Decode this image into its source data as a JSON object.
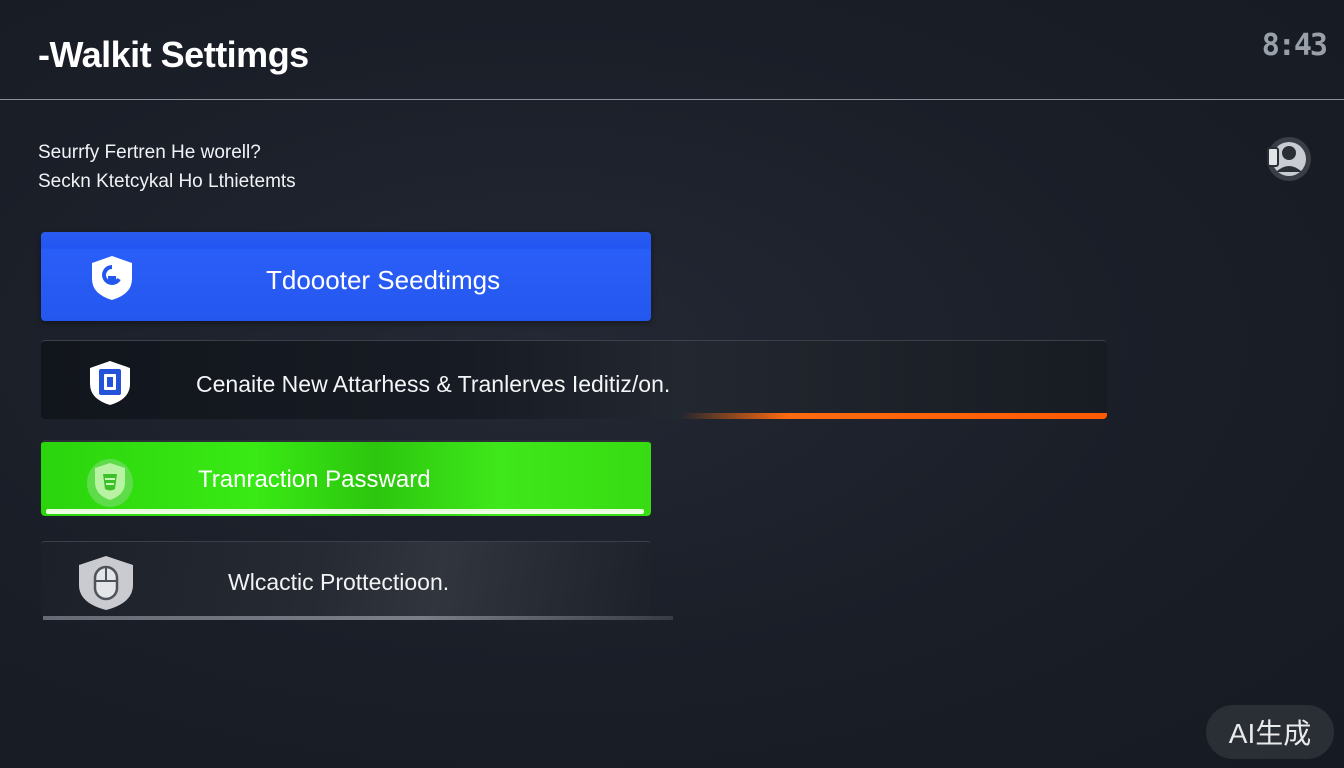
{
  "header": {
    "title": "-Walkit Settimgs",
    "clock": "8:43"
  },
  "subtitle": {
    "line1": "Seurrfy Fertren He worell?",
    "line2": "Seckn Ktetcykal Ho Lthietemts"
  },
  "options": [
    {
      "label": "Tdoooter Seedtimgs",
      "icon": "shield-icon",
      "color": "#2457ee"
    },
    {
      "label": "Cenaite New Attarhess & Tranlerves Ieditiz/on.",
      "icon": "shield-lock-icon",
      "color": "#ff5a00"
    },
    {
      "label": "Tranraction Passward",
      "icon": "green-shield-icon",
      "color": "#39ea14"
    },
    {
      "label": "Wlcactic Prottectioon.",
      "icon": "mouse-shield-icon",
      "color": "#7a7f88"
    }
  ],
  "badge": {
    "label": "AI生成"
  },
  "colors": {
    "background": "#1b1f29",
    "accent_blue": "#2457ee",
    "accent_green": "#39ea14",
    "accent_orange": "#ff5a00"
  }
}
